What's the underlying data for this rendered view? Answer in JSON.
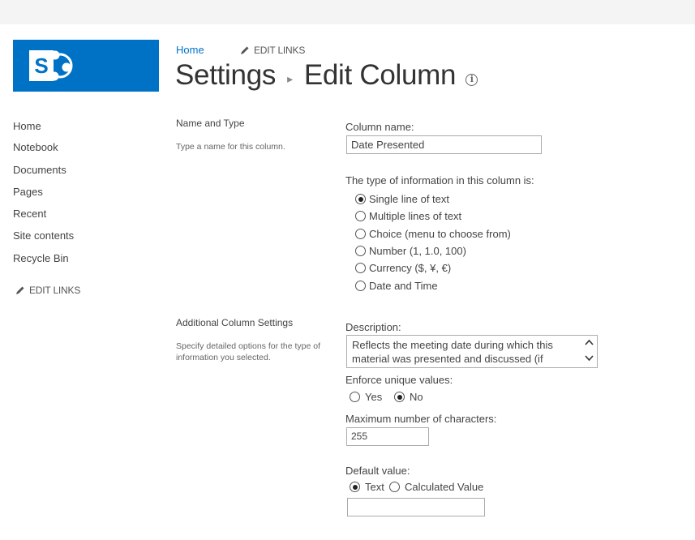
{
  "top_nav": {
    "home": "Home",
    "edit_links": "EDIT LINKS"
  },
  "title": {
    "settings": "Settings",
    "page": "Edit Column"
  },
  "left_nav": {
    "items": [
      "Home",
      "Notebook",
      "Documents",
      "Pages",
      "Recent",
      "Site contents",
      "Recycle Bin"
    ],
    "edit_links": "EDIT LINKS"
  },
  "name_type_section": {
    "title": "Name and Type",
    "description": "Type a name for this column.",
    "column_name_label": "Column name:",
    "column_name_value": "Date Presented",
    "type_label": "The type of information in this column is:",
    "types": [
      {
        "label": "Single line of text",
        "checked": true
      },
      {
        "label": "Multiple lines of text",
        "checked": false
      },
      {
        "label": "Choice (menu to choose from)",
        "checked": false
      },
      {
        "label": "Number (1, 1.0, 100)",
        "checked": false
      },
      {
        "label": "Currency ($, ¥, €)",
        "checked": false
      },
      {
        "label": "Date and Time",
        "checked": false
      }
    ]
  },
  "additional_section": {
    "title": "Additional Column Settings",
    "description": "Specify detailed options for the type of information you selected.",
    "description_label": "Description:",
    "description_value": "Reflects the meeting date during which this material was presented and discussed (if",
    "enforce_label": "Enforce unique values:",
    "enforce_yes": "Yes",
    "enforce_no": "No",
    "max_chars_label": "Maximum number of characters:",
    "max_chars_value": "255",
    "default_label": "Default value:",
    "default_text": "Text",
    "default_calculated": "Calculated Value",
    "default_value": ""
  },
  "colors": {
    "accent": "#0072c6",
    "topbar": "#f4f4f4"
  }
}
